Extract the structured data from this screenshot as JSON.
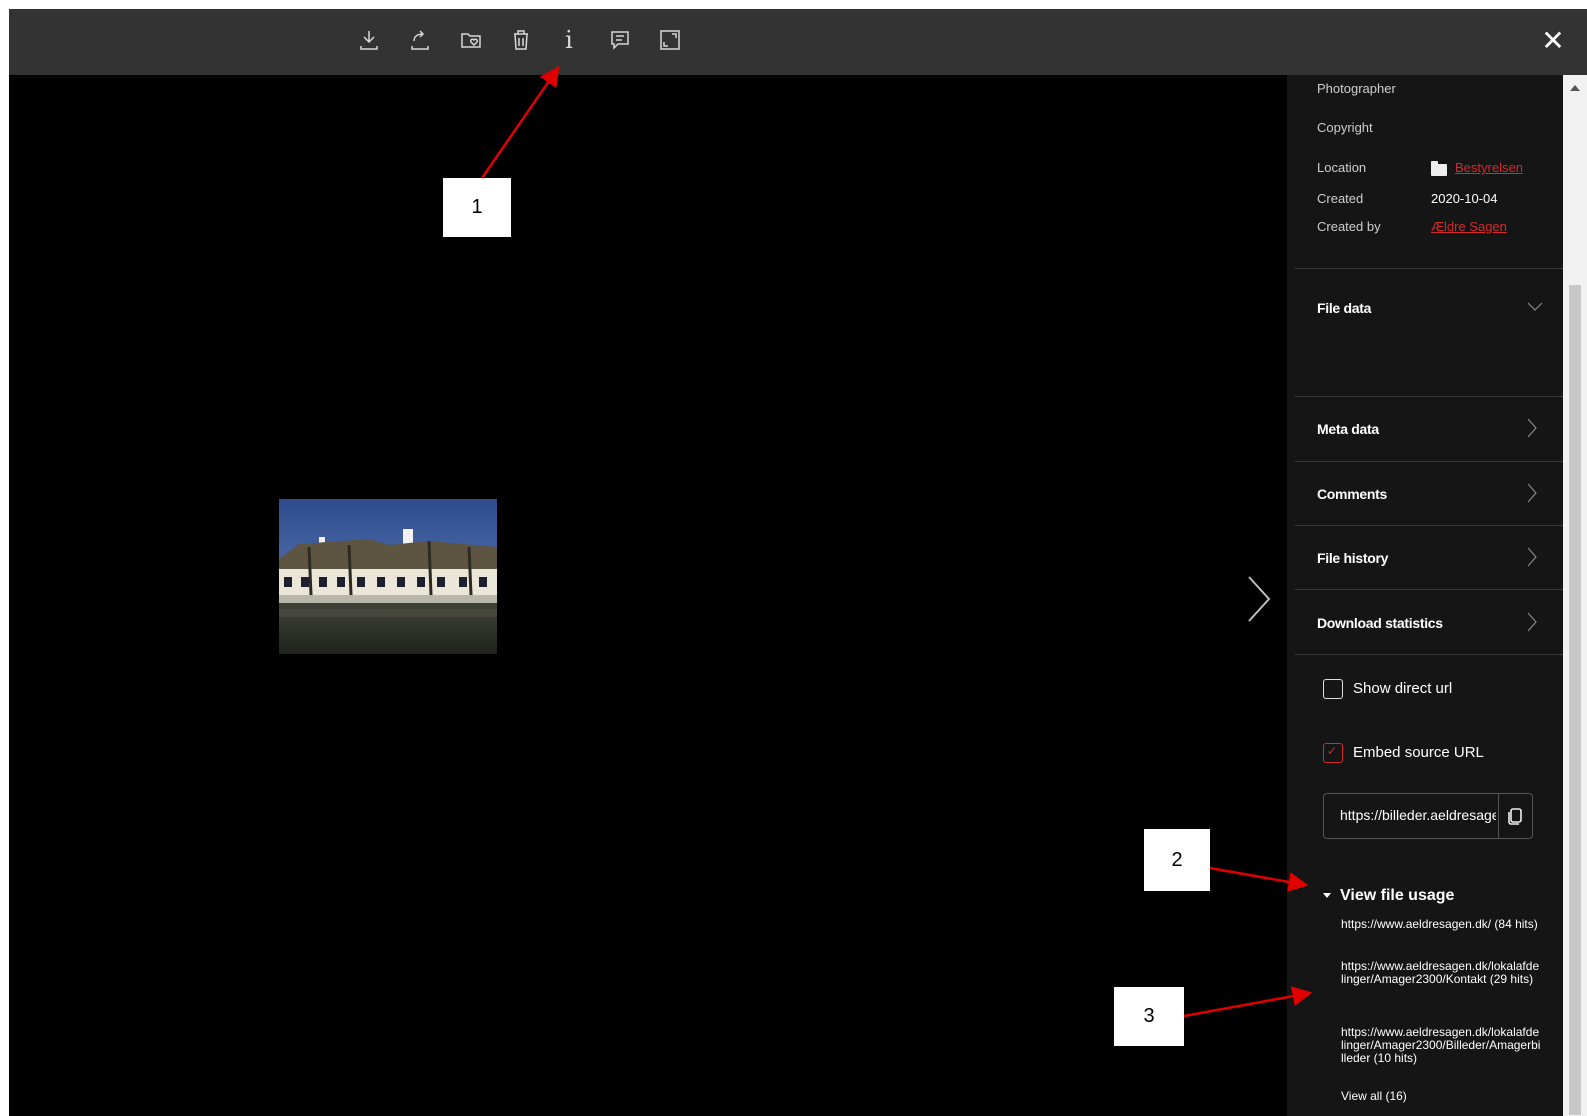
{
  "toolbar": {
    "icons": [
      "download-icon",
      "share-icon",
      "add-to-folder-icon",
      "trash-icon",
      "info-icon",
      "comment-icon",
      "fullscreen-icon"
    ],
    "close_label": "✕"
  },
  "details": {
    "photographer_label": "Photographer",
    "copyright_label": "Copyright",
    "location_label": "Location",
    "location_value": "Bestyrelsen",
    "created_label": "Created",
    "created_value": "2020-10-04",
    "created_by_label": "Created by",
    "created_by_value": "Ældre Sagen"
  },
  "sections": {
    "file_data": "File data",
    "meta_data": "Meta data",
    "comments": "Comments",
    "file_history": "File history",
    "download_statistics": "Download statistics"
  },
  "options": {
    "show_direct_url": "Show direct url",
    "show_direct_url_checked": false,
    "embed_source_url": "Embed source URL",
    "embed_source_url_checked": true,
    "url_value": "https://billeder.aeldresagen.dk"
  },
  "usage": {
    "heading": "View file usage",
    "items": [
      "https://www.aeldresagen.dk/ (84 hits)",
      "https://www.aeldresagen.dk/lokalafdelinger/Amager2300/Kontakt (29 hits)",
      "https://www.aeldresagen.dk/lokalafdelinger/Amager2300/Billeder/Amagerbilleder (10 hits)"
    ],
    "view_all": "View all (16)"
  },
  "annotations": [
    "1",
    "2",
    "3"
  ],
  "colors": {
    "accent": "#d42a2a",
    "toolbar": "#333333",
    "panel": "#151515",
    "annotation_arrow": "#e00000"
  }
}
